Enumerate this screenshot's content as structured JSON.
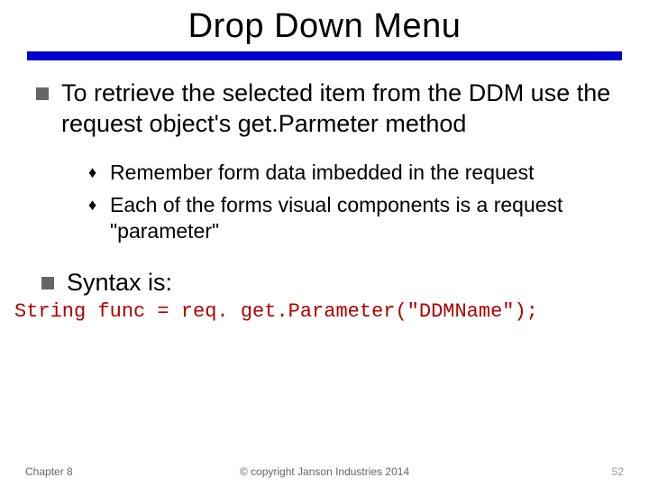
{
  "title": "Drop Down Menu",
  "bullet1": "To retrieve the selected item from the DDM use the request object's get.Parmeter method",
  "sub1": "Remember form data imbedded in the request",
  "sub2": "Each of the forms visual components is a request \"parameter\"",
  "bullet2": "Syntax is:",
  "code": "String func = req. get.Parameter(\"DDMName\");",
  "footer": {
    "left": "Chapter 8",
    "center": "© copyright Janson Industries 2014",
    "pagenum": "52"
  }
}
